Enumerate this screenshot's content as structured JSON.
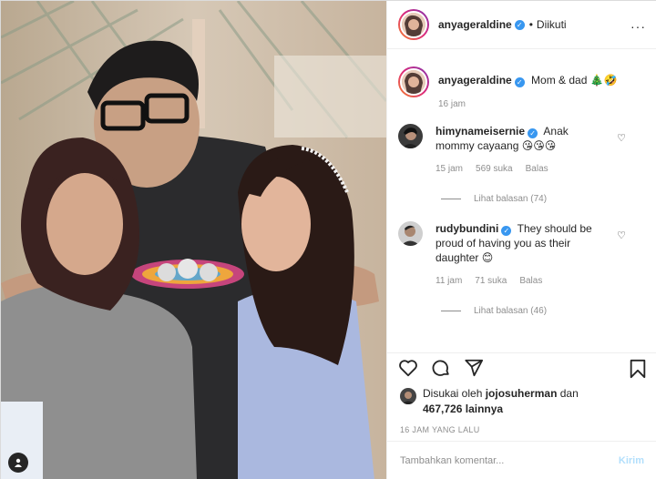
{
  "post": {
    "username": "anyageraldine",
    "follow_state": "Diikuti",
    "more_icon": "more-horizontal-icon"
  },
  "caption": {
    "username": "anyageraldine",
    "text": "Mom & dad 🎄🤣",
    "time": "16 jam"
  },
  "comments": [
    {
      "username": "himynameisernie",
      "text": "Anak mommy cayaang 😘😘😘",
      "time": "15 jam",
      "likes": "569 suka",
      "reply": "Balas",
      "view_replies": "Lihat balasan (74)"
    },
    {
      "username": "rudybundini",
      "text": "They should be proud of having you as their daughter 😊",
      "time": "11 jam",
      "likes": "71 suka",
      "reply": "Balas",
      "view_replies": "Lihat balasan (46)"
    }
  ],
  "likes_info": {
    "prefix": "Disukai oleh",
    "user": "jojosuherman",
    "connector": "dan",
    "count": "467,726",
    "suffix": "lainnya"
  },
  "timestamp": "16 JAM YANG LALU",
  "comment_box": {
    "placeholder": "Tambahkan komentar...",
    "post_label": "Kirim"
  },
  "colors": {
    "verified": "#3897f0",
    "post_button_disabled": "#b2dffc",
    "secondary_text": "#8e8e8e"
  }
}
